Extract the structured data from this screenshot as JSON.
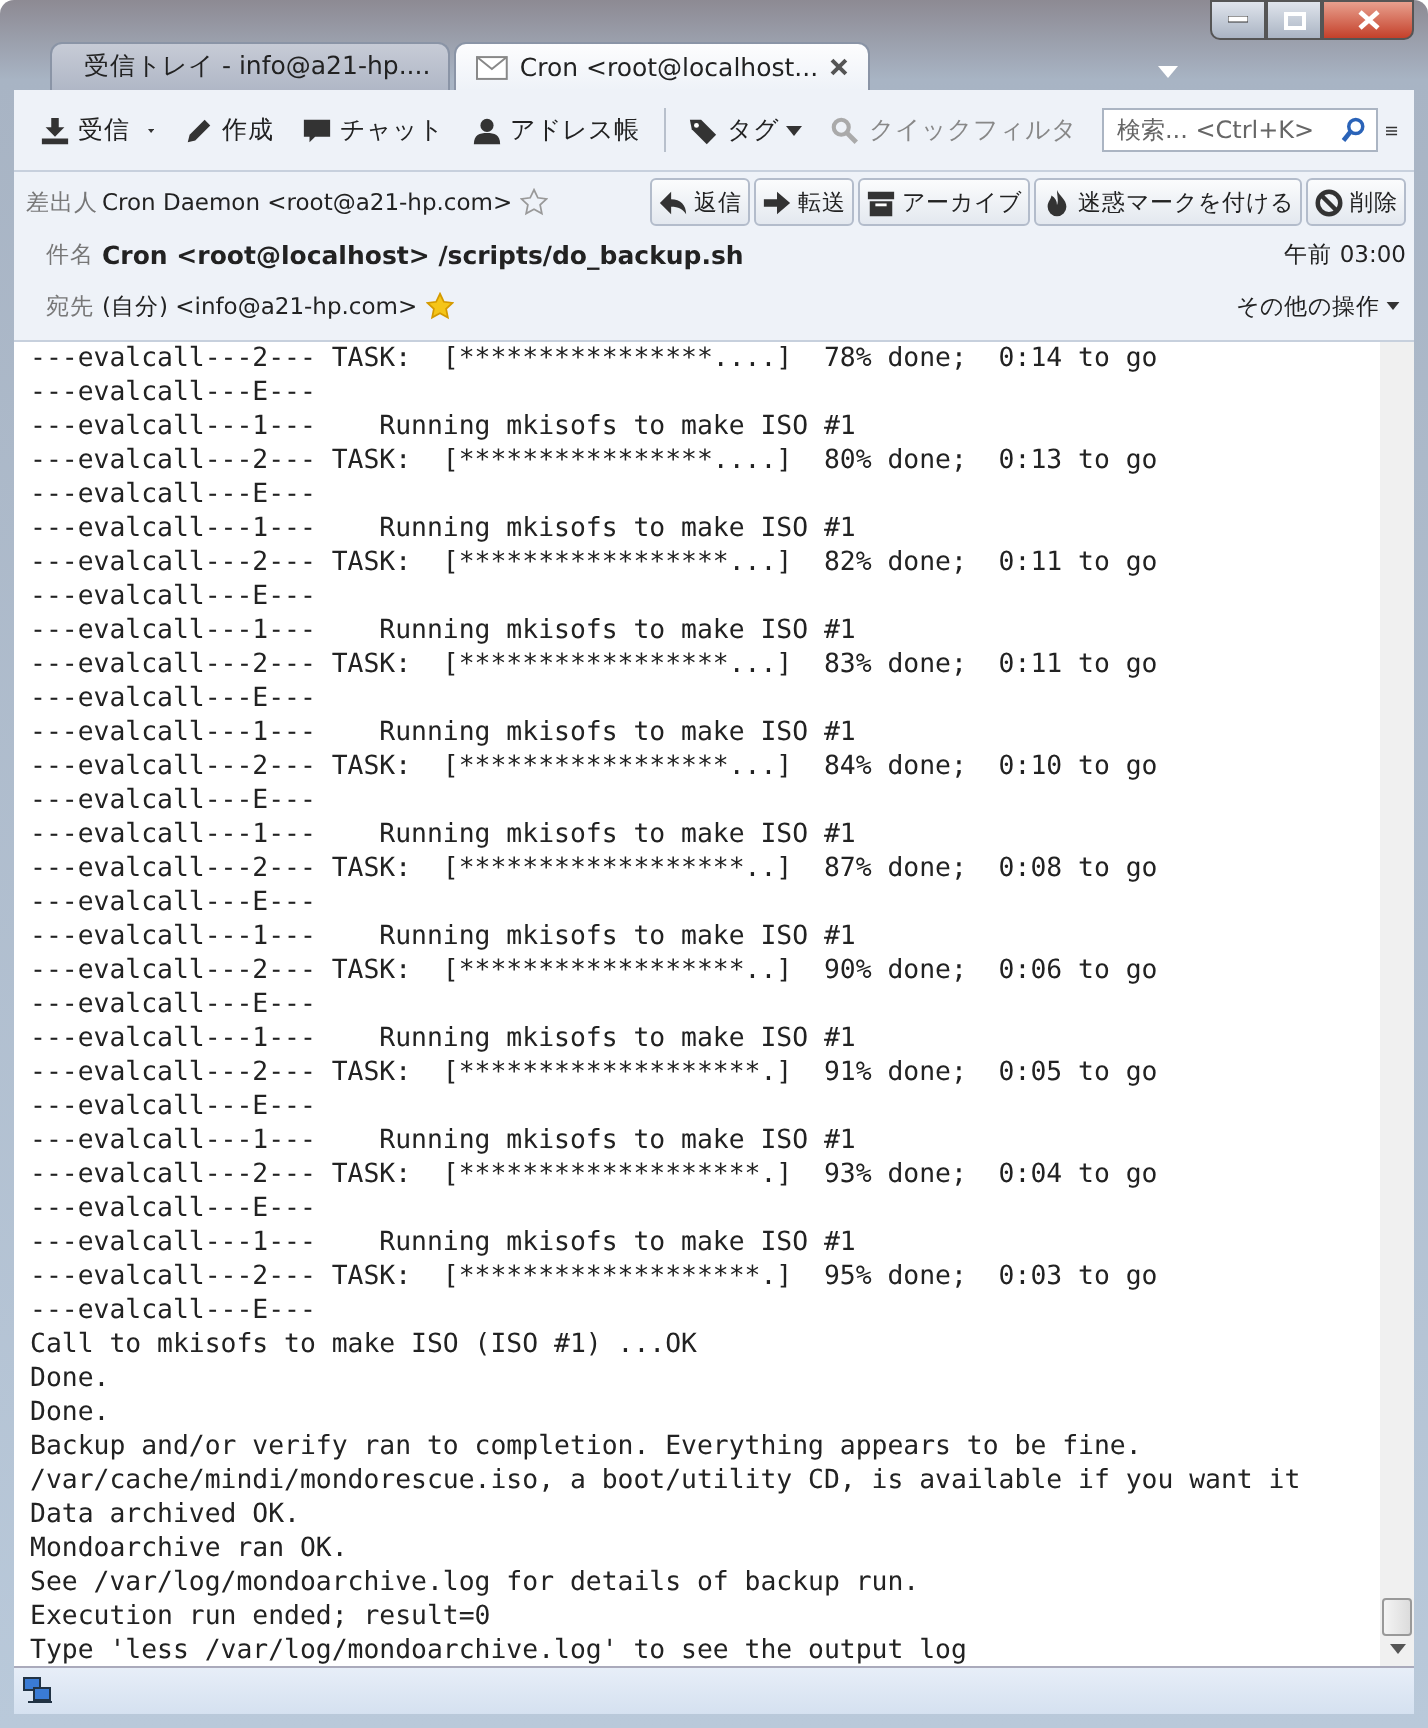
{
  "tabs": [
    {
      "label": "受信トレイ - info@a21-hp....",
      "kind": "inbox",
      "selected": false
    },
    {
      "label": "Cron <root@localhost...",
      "kind": "mail",
      "selected": true
    }
  ],
  "toolbar": {
    "items": [
      {
        "label": "受信",
        "kind": "get"
      },
      {
        "label": "作成",
        "kind": "write"
      },
      {
        "label": "チャット",
        "kind": "chat"
      },
      {
        "label": "アドレス帳",
        "kind": "contacts"
      },
      {
        "label": "タグ",
        "kind": "tag"
      },
      {
        "label": "クイックフィルタ",
        "kind": "filter"
      }
    ],
    "search": {
      "placeholder": "検索... <Ctrl+K>"
    }
  },
  "header": {
    "from_label": "差出人",
    "from": "Cron Daemon <root@a21-hp.com>",
    "from_starred": false,
    "actions": [
      {
        "label": "返信",
        "kind": "reply"
      },
      {
        "label": "転送",
        "kind": "forward"
      },
      {
        "label": "アーカイブ",
        "kind": "archive"
      },
      {
        "label": "迷惑マークを付ける",
        "kind": "junk"
      },
      {
        "label": "削除",
        "kind": "delete"
      }
    ],
    "subject_label": "件名",
    "subject": "Cron <root@localhost> /scripts/do_backup.sh",
    "time": "午前 03:00",
    "to_label": "宛先",
    "to_self": "(自分)",
    "to": "<info@a21-hp.com>",
    "to_starred": true,
    "more": "その他の操作"
  },
  "body_lines": [
    "---evalcall---2--- TASK:  [****************....]  78% done;  0:14 to go",
    "---evalcall---E---",
    "---evalcall---1---    Running mkisofs to make ISO #1",
    "---evalcall---2--- TASK:  [****************....]  80% done;  0:13 to go",
    "---evalcall---E---",
    "---evalcall---1---    Running mkisofs to make ISO #1",
    "---evalcall---2--- TASK:  [*****************...]  82% done;  0:11 to go",
    "---evalcall---E---",
    "---evalcall---1---    Running mkisofs to make ISO #1",
    "---evalcall---2--- TASK:  [*****************...]  83% done;  0:11 to go",
    "---evalcall---E---",
    "---evalcall---1---    Running mkisofs to make ISO #1",
    "---evalcall---2--- TASK:  [*****************...]  84% done;  0:10 to go",
    "---evalcall---E---",
    "---evalcall---1---    Running mkisofs to make ISO #1",
    "---evalcall---2--- TASK:  [******************..]  87% done;  0:08 to go",
    "---evalcall---E---",
    "---evalcall---1---    Running mkisofs to make ISO #1",
    "---evalcall---2--- TASK:  [******************..]  90% done;  0:06 to go",
    "---evalcall---E---",
    "---evalcall---1---    Running mkisofs to make ISO #1",
    "---evalcall---2--- TASK:  [*******************.]  91% done;  0:05 to go",
    "---evalcall---E---",
    "---evalcall---1---    Running mkisofs to make ISO #1",
    "---evalcall---2--- TASK:  [*******************.]  93% done;  0:04 to go",
    "---evalcall---E---",
    "---evalcall---1---    Running mkisofs to make ISO #1",
    "---evalcall---2--- TASK:  [*******************.]  95% done;  0:03 to go",
    "---evalcall---E---",
    "Call to mkisofs to make ISO (ISO #1) ...OK",
    "Done.",
    "Done.",
    "Backup and/or verify ran to completion. Everything appears to be fine.",
    "/var/cache/mindi/mondorescue.iso, a boot/utility CD, is available if you want it",
    "Data archived OK.",
    "Mondoarchive ran OK.",
    "See /var/log/mondoarchive.log for details of backup run.",
    "Execution run ended; result=0",
    "Type 'less /var/log/mondoarchive.log' to see the output log"
  ]
}
